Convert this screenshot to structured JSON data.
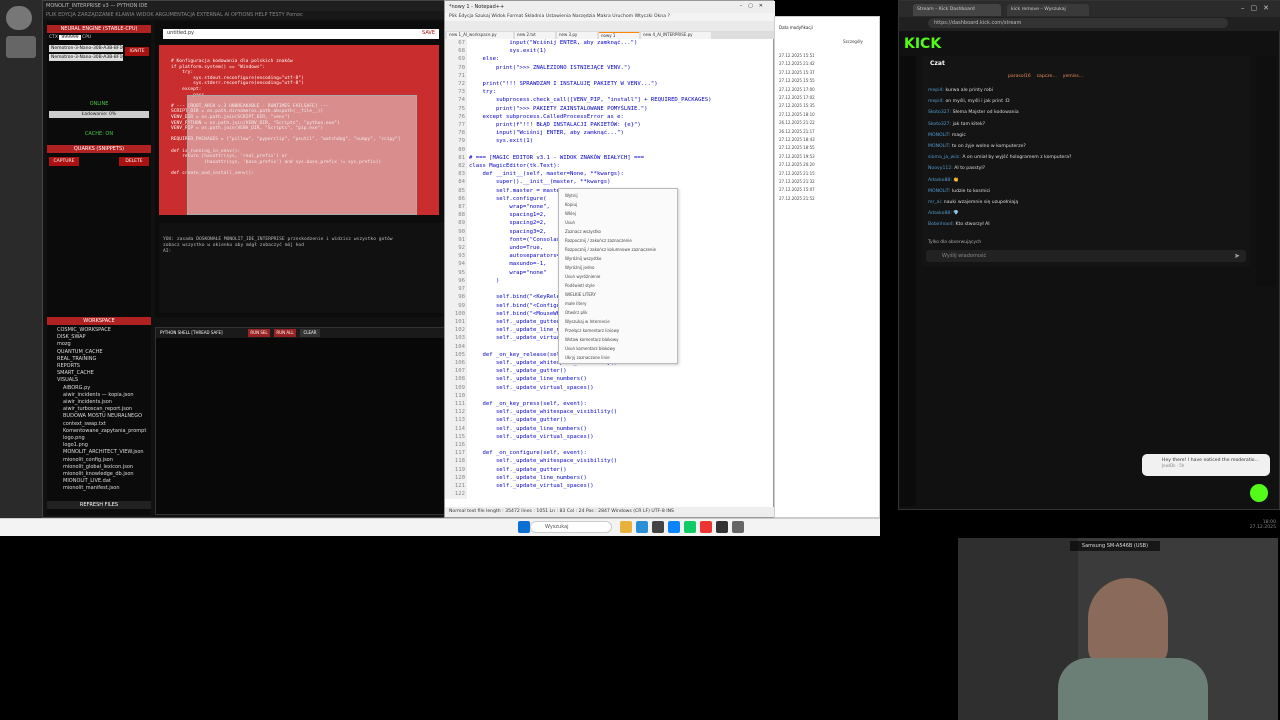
{
  "ide": {
    "title": "MONOLIT_INTERPRISE v3 — PYTHON IDE",
    "menu": "PLIK   EDYCJA   ZARZĄDZANIE   KLAWIA   WIDOK   ARGUMENTACJA   EXTERNAL AI   OPTIONS   HELP   TESTY   Pomoc",
    "left_panel": {
      "engine_header": "NEURAL ENGINE (STABLE-CPU)",
      "ctx_label": "CTX",
      "ctx_value": "999999",
      "cpu_label": "CPU",
      "models": [
        "Nemotron-3-Nano-30B-A3B-BF16-0000",
        "Nemotron-3-Nano-30B-A3B-BF16-000"
      ],
      "ignite": "IGNITE",
      "online": "ONLINE",
      "loading": "Ładowanie: 0%",
      "loading_pct": 0,
      "cache": "CACHE: ON",
      "quarks_header": "QUARKS (SNIPPETS)",
      "capture": "CAPTURE",
      "delete": "DELETE",
      "workspace_header": "WORKSPACE",
      "tree": [
        "COSMIC_WORKSPACE",
        "DISK_SWAP",
        "mozg",
        "QUANTUM_CACHE",
        "REAL_TRAINING",
        "REPORTS",
        "SMART_CACHE",
        "VISUALS",
        "AIBORG.py",
        "aiwir_incidents — kopia.json",
        "aiwir_incidents.json",
        "aiwir_turboscan_report.json",
        "BUDOWA MOSTU NEURALNEGO",
        "context_swap.txt",
        "Komentowane_zapytania_prompt",
        "logo.png",
        "logo1.png",
        "MONOLIT_ARCHITECT_VIEW.json",
        "mionolit_config.json",
        "mionolit_global_lexicon.json",
        "mionolit_knowledge_db.json",
        "MIONOLIT_LIVE.dat",
        "mionolit_manifest.json"
      ],
      "refresh": "REFRESH FILES"
    },
    "editor_tab": "untitled.py",
    "editor_close": "SAVE",
    "editor_code": "# Konfiguracja kodowania dla polskich znaków\nif platform.system() == \"Windows\":\n    try:\n        sys.stdout.reconfigure(encoding=\"utf-8\")\n        sys.stderr.reconfigure(encoding=\"utf-8\")\n    except:\n        pass\n\n# --- [ROOT_ARCH v.3 UNBREAKABLE - RUNTIMES FAILSAFE] ---\nSCRIPT_DIR = os.path.dirname(os.path.abspath(__file__))\nVENV_DIR = os.path.join(SCRIPT_DIR, \"venv\")\nVENV_PYTHON = os.path.join(VENV_DIR, \"Scripts\", \"python.exe\")\nVENV_PIP = os.path.join(VENV_DIR, \"Scripts\", \"pip.exe\")\n\nREQUIRED_PACKAGES = [\"pillow\", \"pyperclip\", \"psutil\", \"watchdog\", \"numpy\", \"scipy\"]\n\ndef is_running_in_venv():\n    return (hasattr(sys, 'real_prefix') or\n            (hasattr(sys, 'base_prefix') and sys.base_prefix != sys.prefix))\n\ndef create_and_install_venv():",
    "output_text": "YOU: zasada DOSKONAŁE MONOLIT_IDE_INTERPRISE przeskodzenie i widzisz wszystko gotów\nzobacz wszystko w okienku aby mógł zobaczyć mój kod\nAI:",
    "shell": {
      "title": "PYTHON SHELL [THREAD SAFE]",
      "run_sel": "RUN SEL",
      "run_all": "RUN ALL",
      "clear": "CLEAR"
    }
  },
  "notepad": {
    "title": "*nowy 1 - Notepad++",
    "menu": "Plik   Edycja   Szukaj   Widok   Format   Składnia   Ustawienia   Narzędzia   Makra   Uruchom   Wtyczki   Okna   ?",
    "tabs": [
      "new 1_AI_workspace.py",
      "new 2.txt",
      "new 3.py",
      "nowy 1",
      "new 4_AI_INTERPRISE.py"
    ],
    "line_numbers": "67\n68\n69\n70\n71\n72\n73\n74\n75\n76\n77\n78\n79\n80\n81\n82\n83\n84\n85\n86\n87\n88\n89\n90\n91\n92\n93\n94\n95\n96\n97\n98\n99\n100\n101\n102\n103\n104\n105\n106\n107\n108\n109\n110\n111\n112\n113\n114\n115\n116\n117\n118\n119\n120\n121\n122",
    "code": "            input(\"Wciśnij ENTER, aby zamknąć...\")\n            sys.exit(1)\n    else:\n        print(\">>> ZNALEZIONO ISTNIEJĄCE VENV.\")\n\n    print(\"!!! SPRAWDZAM I INSTALUJĘ PAKIETY W VENV...\")\n    try:\n        subprocess.check_call([VENV_PIP, \"install\"] + REQUIRED_PACKAGES)\n        print(\">>> PAKIETY ZAINSTALOWANE POMYŚLNIE.\")\n    except subprocess.CalledProcessError as e:\n        print(f\"!!! BŁĄD INSTALACJI PAKIETÓW: {e}\")\n        input(\"Wciśnij ENTER, aby zamknąć...\")\n        sys.exit(1)\n\n# === [MAGIC EDITOR v3.1 - WIDOK ZNAKÓW BIAŁYCH] ===\nclass MagicEditor(tk.Text):\n    def __init__(self, master=None, **kwargs):\n        super().__init__(master, **kwargs)\n        self.master = master\n        self.configure(\n            wrap=\"none\",\n            spacing1=2,\n            spacing2=2,\n            spacing3=2,\n            font=(\"Consolas\", 11),\n            undo=True,\n            autoseparators=True,\n            maxundo=-1,\n            wrap=\"none\"\n        )\n\n        self.bind(\"<KeyRelease>\", self._on_key_release)\n        self.bind(\"<Configure>\", self._on_configure)\n        self.bind(\"<MouseWheel>\", self._on_mousewheel)\n        self._update_gutter()\n        self._update_line_numbers()\n        self._update_virtual_spaces()\n\n    def _on_key_release(self, event):\n        self._update_whitespace_visibility()\n        self._update_gutter()\n        self._update_line_numbers()\n        self._update_virtual_spaces()\n\n    def _on_key_press(self, event):\n        self._update_whitespace_visibility()\n        self._update_gutter()\n        self._update_line_numbers()\n        self._update_virtual_spaces()\n\n    def _on_configure(self, event):\n        self._update_whitespace_visibility()\n        self._update_gutter()\n        self._update_line_numbers()\n        self._update_virtual_spaces()",
    "context_menu": [
      "Wytnij",
      "Kopiuj",
      "Wklej",
      "Usuń",
      "Zaznacz wszystko",
      "Rozpocznij / zakończ zaznaczenie",
      "Rozpocznij / zakończ kolumnowe zaznaczenie",
      "Wyróżnij wszystko",
      "Wyróżnij jedno",
      "Usuń wyróżnienie",
      "Podświetl style",
      "WIELKIE LITERY",
      "małe litery",
      "Otwórz plik",
      "Wyszukaj w Internecie",
      "Przełącz komentarz liniowy",
      "Wstaw komentarz blokowy",
      "Usuń komentarz blokowy",
      "Ukryj zaznaczone linie"
    ],
    "status": "Normal text file        length : 35472   lines : 1051        Ln : 83   Col : 24   Pos : 2847        Windows (CR LF)   UTF-8        INS"
  },
  "explorer": {
    "header": "Data modyfikacji",
    "search": "Szczegóły",
    "dates": [
      "27.12.2025 15:51",
      "27.12.2025 21:42",
      "27.12.2025 15:37",
      "27.12.2025 15:55",
      "27.12.2025 17:00",
      "27.12.2025 17:02",
      "27.12.2025 15:35",
      "27.12.2025 18:10",
      "26.12.2025 21:22",
      "26.12.2025 21:17",
      "27.12.2025 18:43",
      "27.12.2025 18:55",
      "27.12.2025 19:53",
      "27.12.2025 20:20",
      "27.12.2025 21:15",
      "27.12.2025 21:32",
      "27.12.2025 15:07",
      "27.12.2025 21:52"
    ]
  },
  "browser": {
    "tabs": [
      "Stream – Kick Dashboard",
      "kick remove – Wyszukaj"
    ],
    "url": "https://dashboard.kick.com/stream",
    "logo": "KICK",
    "chat_title": "Czat",
    "pinned": [
      "parasol16",
      "sapcze...",
      "yemiss..."
    ],
    "messages": [
      {
        "user": "mepi4:",
        "text": "kurwa ale printy robi"
      },
      {
        "user": "mepi4:",
        "text": "on myśli, myśli i jak print :D"
      },
      {
        "user": "Skoto327:",
        "text": "Słema Majster od kodowania"
      },
      {
        "user": "Skoto327:",
        "text": "jak tam kitek?"
      },
      {
        "user": "MONOLIT:",
        "text": "magic"
      },
      {
        "user": "MONOLIT:",
        "text": "to on żyje wolno w komputerze?"
      },
      {
        "user": "sioma_ja_wiic:",
        "text": "A on umiał by wyjść hologramem z komputera?"
      },
      {
        "user": "Noovy112:",
        "text": "AI to passtyl?"
      },
      {
        "user": "Adasko88:",
        "text": "👏"
      },
      {
        "user": "MONOLIT:",
        "text": "ludzie to kosmici"
      },
      {
        "user": "mr_ai:",
        "text": "nauki wzajemnie się uzupełniają"
      },
      {
        "user": "Adasko88:",
        "text": "💎"
      },
      {
        "user": "Bobinhood:",
        "text": "Kto stworzył AI"
      }
    ],
    "followers_only": "Tylko dla obserwujących",
    "input_placeholder": "Wyślij wiadomość",
    "notice": "Hey there! I have noticed the moderatio...",
    "notice_sub": "JewlDk · 5h"
  },
  "taskbar": {
    "search": "Wyszukaj",
    "clock_time": "18:00",
    "clock_date": "27.12.2025"
  },
  "webcam": {
    "label": "Samsung SM-A546B (USB)"
  },
  "colors": {
    "accent_red": "#b02222",
    "kick_green": "#53fc18",
    "code_blue": "#0000c8"
  }
}
